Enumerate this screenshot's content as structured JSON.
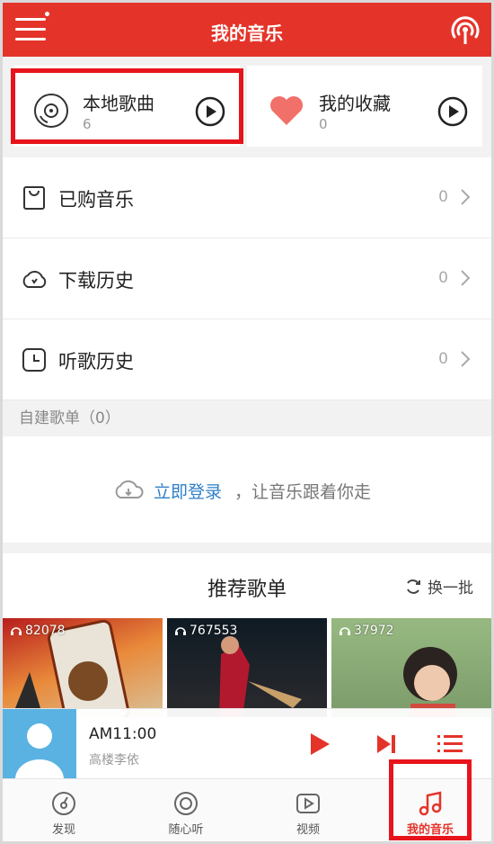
{
  "header": {
    "title": "我的音乐",
    "menu_icon": "hamburger-menu-icon",
    "radio_icon": "radio-broadcast-icon"
  },
  "cards": {
    "local": {
      "title": "本地歌曲",
      "count": "6",
      "icon": "cd-disc-icon"
    },
    "favorites": {
      "title": "我的收藏",
      "count": "0",
      "icon": "heart-icon"
    }
  },
  "list": [
    {
      "label": "已购音乐",
      "count": "0",
      "icon": "purchase-bag-icon"
    },
    {
      "label": "下载历史",
      "count": "0",
      "icon": "cloud-download-icon"
    },
    {
      "label": "听歌历史",
      "count": "0",
      "icon": "clock-icon"
    }
  ],
  "playlists_section": {
    "title": "自建歌单（0）",
    "login_link": "立即登录",
    "login_rest": "，让音乐跟着你走"
  },
  "recommend": {
    "title": "推荐歌单",
    "refresh": "换一批",
    "items": [
      {
        "plays": "82078"
      },
      {
        "plays": "767553"
      },
      {
        "plays": "37972"
      }
    ]
  },
  "player": {
    "song": "AM11:00",
    "artist": "高楼李依"
  },
  "nav": [
    {
      "label": "发现",
      "icon": "discover-icon"
    },
    {
      "label": "随心听",
      "icon": "radio-listen-icon"
    },
    {
      "label": "视频",
      "icon": "video-play-icon"
    },
    {
      "label": "我的音乐",
      "icon": "music-note-icon"
    }
  ],
  "colors": {
    "brand_red": "#e4342a",
    "highlight_red": "#e8141b",
    "link_blue": "#2f7fc8"
  }
}
